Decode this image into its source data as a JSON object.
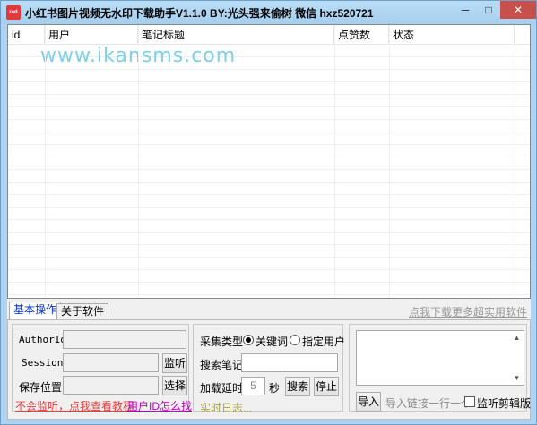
{
  "window": {
    "icon_text": "red",
    "title": "小红书图片视频无水印下载助手V1.1.0   BY:光头强来偷树   微信 hxz520721",
    "controls": {
      "minimize": "─",
      "maximize": "□",
      "close": "✕"
    }
  },
  "table": {
    "columns": [
      "id",
      "用户",
      "笔记标题",
      "点赞数",
      "状态"
    ],
    "rows": []
  },
  "watermark": "www.ikansms.com",
  "tabs": [
    {
      "label": "基本操作",
      "active": true
    },
    {
      "label": "关于软件",
      "active": false
    }
  ],
  "more_link": "点我下载更多超实用软件",
  "left_group": {
    "authorid_label": "AuthorId",
    "authorid_value": "",
    "session_label": "Session",
    "session_value": "",
    "listen_button": "监听",
    "save_label": "保存位置",
    "save_value": "",
    "choose_button": "选择",
    "help_link": "不会监听，点我查看教程",
    "userid_link": "用户ID怎么找"
  },
  "middle_group": {
    "collect_type_label": "采集类型",
    "radio_keyword": "关键词",
    "radio_user": "指定用户",
    "selected": "关键词",
    "search_label": "搜索笔记",
    "search_value": "",
    "delay_label": "加载延时",
    "delay_value": "5",
    "delay_unit": "秒",
    "search_button": "搜索",
    "stop_button": "停止",
    "log_label": "实时日志..."
  },
  "right_group": {
    "import_value": "",
    "import_button": "导入",
    "import_hint": "导入链接一行一个",
    "clipboard_checkbox": "监听剪辑版",
    "clipboard_checked": false
  }
}
